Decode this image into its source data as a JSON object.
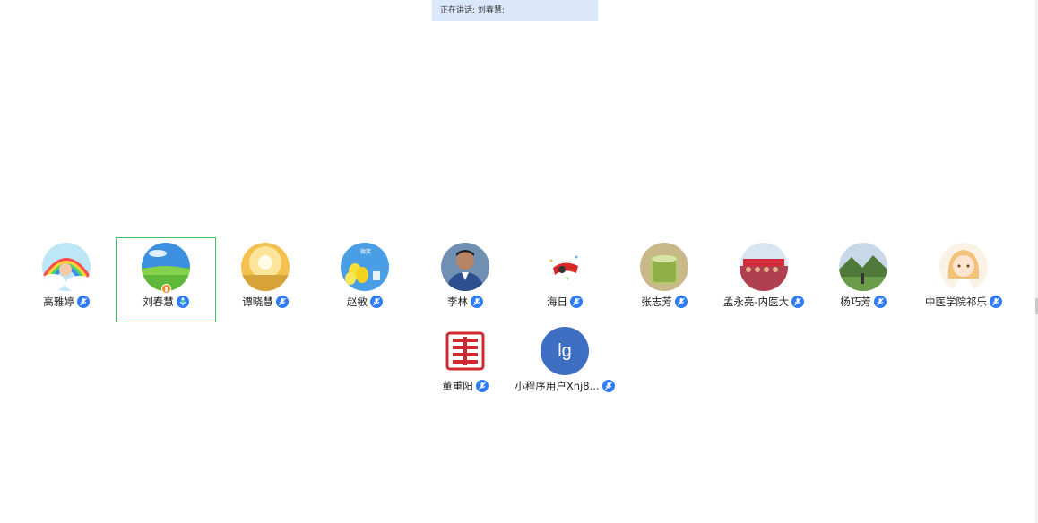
{
  "speaking": {
    "text": "正在讲话: 刘春慧;"
  },
  "participants": [
    {
      "name": "高雅婷",
      "avatar": "rainbow-cartoon-avatar",
      "mic": "muted"
    },
    {
      "name": "刘春慧",
      "avatar": "green-meadow-avatar",
      "mic": "speaking",
      "active": true,
      "host": true
    },
    {
      "name": "谭晓慧",
      "avatar": "sunburst-avatar",
      "mic": "muted"
    },
    {
      "name": "赵敏",
      "avatar": "yellow-balloons-avatar",
      "mic": "muted",
      "avatar_caption": "微笑"
    },
    {
      "name": "李林",
      "avatar": "man-portrait-avatar",
      "mic": "muted"
    },
    {
      "name": "海日",
      "avatar": "red-flag-avatar",
      "mic": "muted"
    },
    {
      "name": "张志芳",
      "avatar": "green-tea-avatar",
      "mic": "muted"
    },
    {
      "name": "孟永亮-内医大",
      "avatar": "group-photo-avatar",
      "mic": "muted"
    },
    {
      "name": "杨巧芳",
      "avatar": "mountain-landscape-avatar",
      "mic": "muted"
    },
    {
      "name": "中医学院祁乐",
      "avatar": "anime-girl-avatar",
      "mic": "muted"
    },
    {
      "name": "董重阳",
      "avatar": "red-seal-avatar",
      "mic": "muted"
    },
    {
      "name": "小程序用户Xnj8...",
      "avatar": "initials-avatar",
      "initials": "lg",
      "mic": "muted"
    }
  ],
  "colors": {
    "accent": "#2f7cf6",
    "active_border": "#3cc06a",
    "speaking_bar": "#dbe8fb",
    "initials_bg": "#3f6fc2",
    "host_badge": "#f08c2a"
  }
}
